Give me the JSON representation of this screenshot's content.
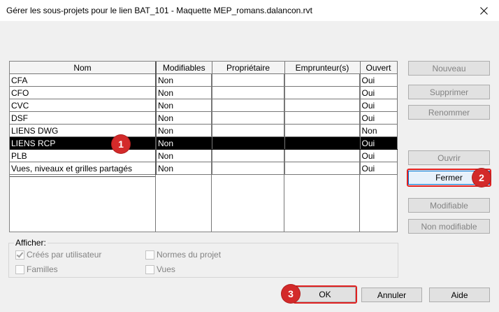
{
  "window": {
    "title": "Gérer les sous-projets pour le lien BAT_101 - Maquette MEP_romans.dalancon.rvt"
  },
  "table": {
    "columns": [
      "Nom",
      "Modifiables",
      "Propriétaire",
      "Emprunteur(s)",
      "Ouvert"
    ],
    "rows": [
      {
        "nom": "CFA",
        "modifiables": "Non",
        "proprietaire": "",
        "emprunteurs": "",
        "ouvert": "Oui"
      },
      {
        "nom": "CFO",
        "modifiables": "Non",
        "proprietaire": "",
        "emprunteurs": "",
        "ouvert": "Oui"
      },
      {
        "nom": "CVC",
        "modifiables": "Non",
        "proprietaire": "",
        "emprunteurs": "",
        "ouvert": "Oui"
      },
      {
        "nom": "DSF",
        "modifiables": "Non",
        "proprietaire": "",
        "emprunteurs": "",
        "ouvert": "Oui"
      },
      {
        "nom": "LIENS DWG",
        "modifiables": "Non",
        "proprietaire": "",
        "emprunteurs": "",
        "ouvert": "Non"
      },
      {
        "nom": "LIENS RCP",
        "modifiables": "Non",
        "proprietaire": "",
        "emprunteurs": "",
        "ouvert": "Oui",
        "selected": true
      },
      {
        "nom": "PLB",
        "modifiables": "Non",
        "proprietaire": "",
        "emprunteurs": "",
        "ouvert": "Oui"
      },
      {
        "nom": "Vues, niveaux et grilles partagés",
        "modifiables": "Non",
        "proprietaire": "",
        "emprunteurs": "",
        "ouvert": "Oui"
      }
    ]
  },
  "side_buttons": {
    "nouveau": "Nouveau",
    "supprimer": "Supprimer",
    "renommer": "Renommer",
    "ouvrir": "Ouvrir",
    "fermer": "Fermer",
    "modifiable": "Modifiable",
    "non_modifiable": "Non modifiable"
  },
  "afficher": {
    "label": "Afficher:",
    "options": {
      "crees_par_utilisateur": {
        "label": "Créés par utilisateur",
        "checked": true
      },
      "normes_du_projet": {
        "label": "Normes du projet",
        "checked": false
      },
      "familles": {
        "label": "Familles",
        "checked": false
      },
      "vues": {
        "label": "Vues",
        "checked": false
      }
    }
  },
  "bottom_buttons": {
    "ok": "OK",
    "annuler": "Annuler",
    "aide": "Aide"
  },
  "annotations": {
    "badge1": "1",
    "badge2": "2",
    "badge3": "3",
    "highlight_color": "#e02020"
  }
}
